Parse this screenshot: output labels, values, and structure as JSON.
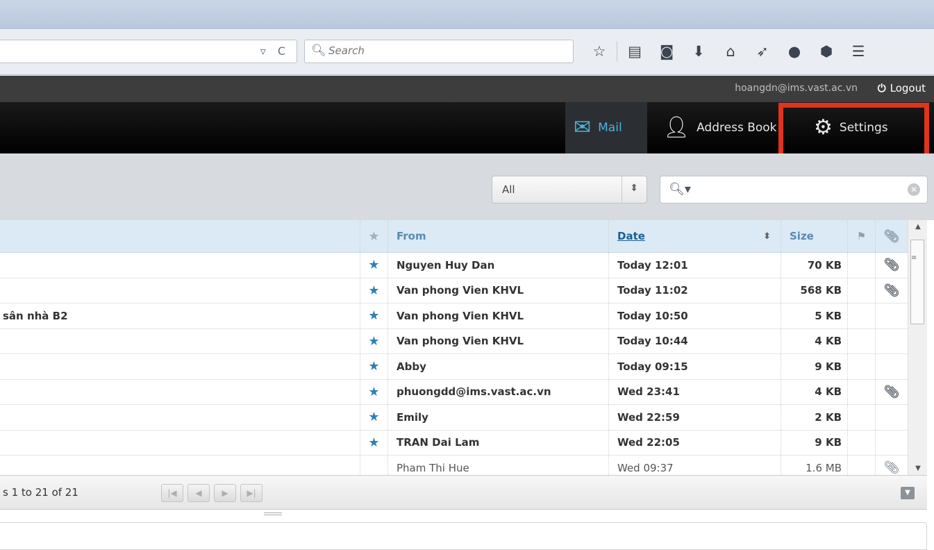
{
  "browser": {
    "search_placeholder": "Search",
    "url_controls": "▿ C",
    "toolbar_icons": [
      "star-icon",
      "reading-list-icon",
      "pocket-icon",
      "download-icon",
      "home-icon",
      "send-icon",
      "chat-icon",
      "extension-icon",
      "hamburger-menu-icon"
    ]
  },
  "header": {
    "user_email": "hoangdn@ims.vast.ac.vn",
    "logout_label": "Logout",
    "nav": {
      "mail": "Mail",
      "address_book": "Address Book",
      "settings": "Settings"
    }
  },
  "filter": {
    "selected": "All",
    "search_value": ""
  },
  "table": {
    "columns": {
      "from": "From",
      "date": "Date",
      "size": "Size"
    },
    "rows": [
      {
        "subject": "",
        "from": "Nguyen Huy Dan",
        "date": "Today 12:01",
        "size": "70 KB",
        "unread": true,
        "attachment": true
      },
      {
        "subject": "",
        "from": "Van phong Vien KHVL",
        "date": "Today 11:02",
        "size": "568 KB",
        "unread": true,
        "attachment": true
      },
      {
        "subject": "sân nhà B2",
        "from": "Van phong Vien KHVL",
        "date": "Today 10:50",
        "size": "5 KB",
        "unread": true,
        "attachment": false
      },
      {
        "subject": "",
        "from": "Van phong Vien KHVL",
        "date": "Today 10:44",
        "size": "4 KB",
        "unread": true,
        "attachment": false
      },
      {
        "subject": "",
        "from": "Abby",
        "date": "Today 09:15",
        "size": "9 KB",
        "unread": true,
        "attachment": false
      },
      {
        "subject": "",
        "from": "phuongdd@ims.vast.ac.vn",
        "date": "Wed 23:41",
        "size": "4 KB",
        "unread": true,
        "attachment": true
      },
      {
        "subject": "",
        "from": "Emily",
        "date": "Wed 22:59",
        "size": "2 KB",
        "unread": true,
        "attachment": false
      },
      {
        "subject": "",
        "from": "TRAN Dai Lam",
        "date": "Wed 22:05",
        "size": "9 KB",
        "unread": true,
        "attachment": false
      },
      {
        "subject": "",
        "from": "Pham Thi Hue",
        "date": "Wed 09:37",
        "size": "1.6 MB",
        "unread": false,
        "attachment": true
      }
    ]
  },
  "pager": {
    "count_text": "s 1 to 21 of 21"
  },
  "colors": {
    "highlight": "#e0341c",
    "accent": "#4bb3de",
    "star": "#2e7fb8"
  }
}
